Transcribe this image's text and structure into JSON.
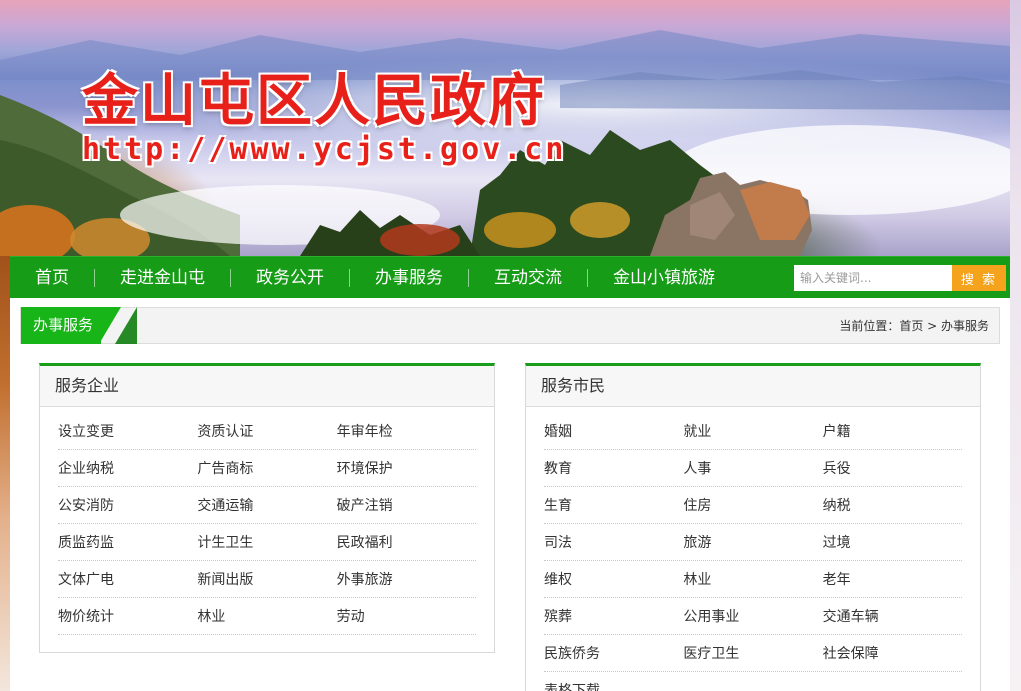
{
  "site": {
    "title": "金山屯区人民政府",
    "url": "http://www.ycjst.gov.cn"
  },
  "nav": {
    "items": [
      "首页",
      "走进金山屯",
      "政务公开",
      "办事服务",
      "互动交流",
      "金山小镇旅游"
    ],
    "search_placeholder": "输入关键词...",
    "search_button": "搜 索"
  },
  "breadcrumb": {
    "tab_label": "办事服务",
    "path": "当前位置：首页 > 办事服务"
  },
  "colors": {
    "nav_green": "#169c16",
    "tab_green": "#18b518",
    "search_orange": "#f5a21c",
    "title_red": "#e8201a"
  },
  "panels": {
    "business": {
      "title": "服务企业",
      "rows": [
        [
          "设立变更",
          "资质认证",
          "年审年检"
        ],
        [
          "企业纳税",
          "广告商标",
          "环境保护"
        ],
        [
          "公安消防",
          "交通运输",
          "破产注销"
        ],
        [
          "质监药监",
          "计生卫生",
          "民政福利"
        ],
        [
          "文体广电",
          "新闻出版",
          "外事旅游"
        ],
        [
          "物价统计",
          "林业",
          "劳动"
        ]
      ]
    },
    "citizen": {
      "title": "服务市民",
      "rows": [
        [
          "婚姻",
          "就业",
          "户籍"
        ],
        [
          "教育",
          "人事",
          "兵役"
        ],
        [
          "生育",
          "住房",
          "纳税"
        ],
        [
          "司法",
          "旅游",
          "过境"
        ],
        [
          "维权",
          "林业",
          "老年"
        ],
        [
          "殡葬",
          "公用事业",
          "交通车辆"
        ],
        [
          "民族侨务",
          "医疗卫生",
          "社会保障"
        ],
        [
          "表格下载",
          "",
          ""
        ]
      ]
    }
  }
}
